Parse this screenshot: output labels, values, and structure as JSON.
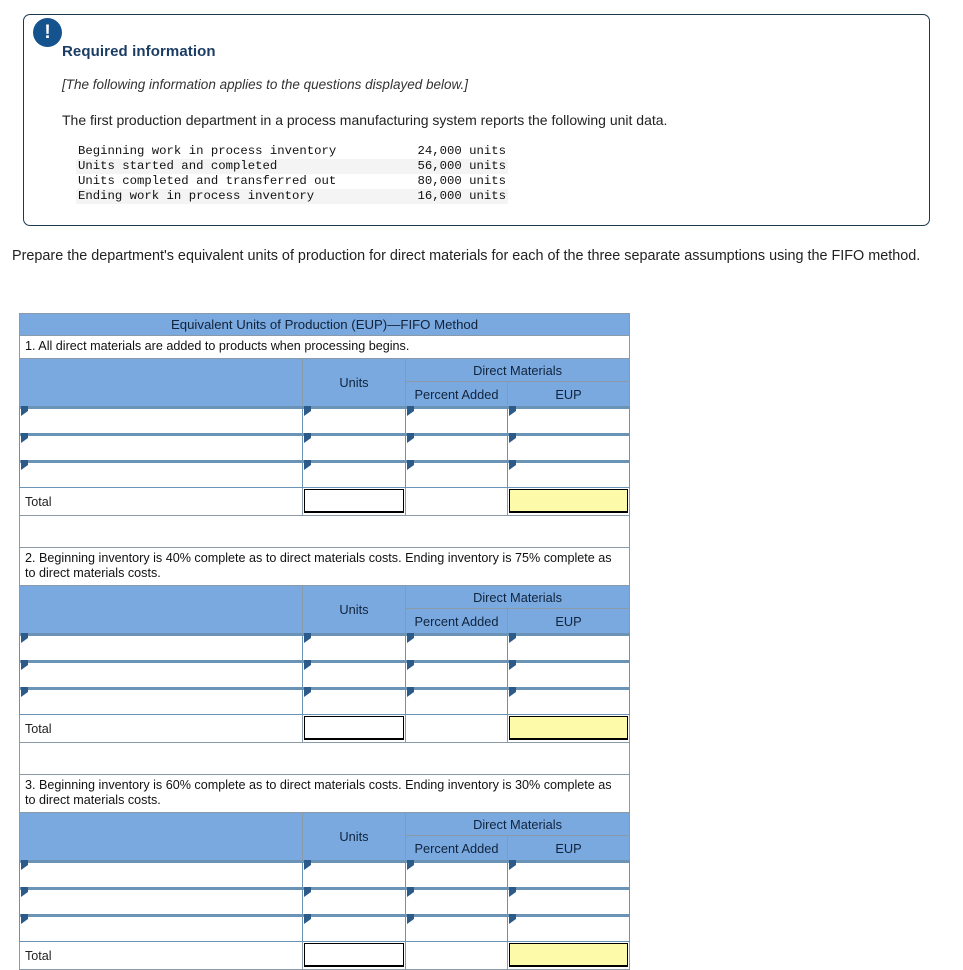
{
  "alert": {
    "icon": "exclamation-circle-icon",
    "title": "Required information",
    "applies_note": "[The following information applies to the questions displayed below.]",
    "intro": "The first production department in a process manufacturing system reports the following unit data.",
    "unit_data": [
      {
        "label": "Beginning work in process inventory",
        "value": "24,000 units"
      },
      {
        "label": "Units started and completed",
        "value": "56,000 units"
      },
      {
        "label": "Units completed and transferred out",
        "value": "80,000 units"
      },
      {
        "label": "Ending work in process inventory",
        "value": "16,000 units"
      }
    ]
  },
  "prompt": "Prepare the department's equivalent units of production for direct materials for each of the three separate assumptions using the FIFO method.",
  "worksheet": {
    "title": "Equivalent Units of Production (EUP)—FIFO Method",
    "columns": {
      "units": "Units",
      "direct_materials": "Direct Materials",
      "percent_added": "Percent Added",
      "eup": "EUP"
    },
    "total_label": "Total",
    "sections": [
      {
        "assumption": "1. All direct materials are added to products when processing begins.",
        "rows": [
          {
            "description": "",
            "units": "",
            "percent_added": "",
            "eup": ""
          },
          {
            "description": "",
            "units": "",
            "percent_added": "",
            "eup": ""
          },
          {
            "description": "",
            "units": "",
            "percent_added": "",
            "eup": ""
          }
        ],
        "total": {
          "units": "",
          "percent_added": "",
          "eup": ""
        }
      },
      {
        "assumption": "2. Beginning inventory is 40% complete as to direct materials costs. Ending inventory is 75% complete as to direct materials costs.",
        "rows": [
          {
            "description": "",
            "units": "",
            "percent_added": "",
            "eup": ""
          },
          {
            "description": "",
            "units": "",
            "percent_added": "",
            "eup": ""
          },
          {
            "description": "",
            "units": "",
            "percent_added": "",
            "eup": ""
          }
        ],
        "total": {
          "units": "",
          "percent_added": "",
          "eup": ""
        }
      },
      {
        "assumption": "3. Beginning inventory is 60% complete as to direct materials costs. Ending inventory is 30% complete as to direct materials costs.",
        "rows": [
          {
            "description": "",
            "units": "",
            "percent_added": "",
            "eup": ""
          },
          {
            "description": "",
            "units": "",
            "percent_added": "",
            "eup": ""
          },
          {
            "description": "",
            "units": "",
            "percent_added": "",
            "eup": ""
          }
        ],
        "total": {
          "units": "",
          "percent_added": "",
          "eup": ""
        }
      }
    ]
  },
  "colors": {
    "header_blue": "#7aa9e0",
    "alert_border": "#1d3a4d",
    "badge_blue": "#15538f",
    "title_navy": "#1b3d63",
    "answer_yellow": "#fdfbaa",
    "grid_gray": "#8a9aa8",
    "input_border_blue": "#6b93b5"
  }
}
